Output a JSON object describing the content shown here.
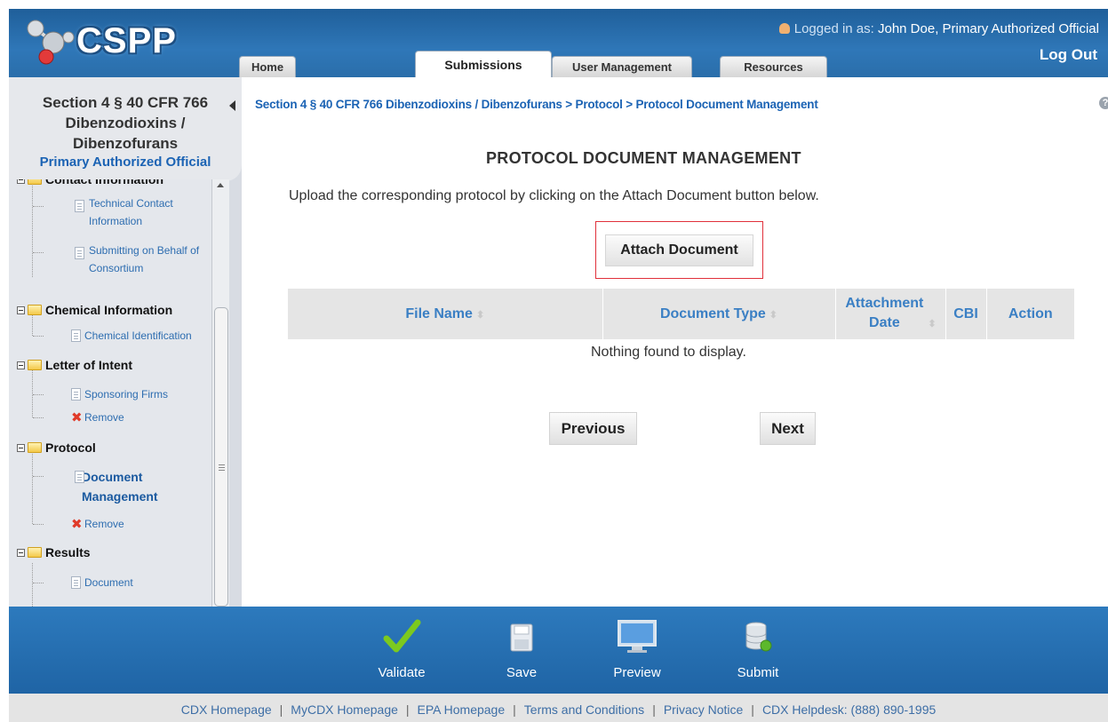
{
  "header": {
    "logo_text": "CSPP",
    "logged_in_prefix": "Logged in as: ",
    "logged_in_user": "John Doe, Primary Authorized Official",
    "logout": "Log Out",
    "tabs": [
      "Home",
      "Submissions",
      "User Management",
      "Resources"
    ],
    "active_tab": "Submissions"
  },
  "sidebar": {
    "title_lines": [
      "Section 4 § 40 CFR 766",
      "Dibenzodioxins /",
      "Dibenzofurans"
    ],
    "role": "Primary Authorized Official",
    "tree": [
      {
        "type": "folder",
        "label": "Contact Information"
      },
      {
        "type": "leaf",
        "label": "Technical Contact Information"
      },
      {
        "type": "leaf",
        "label": "Submitting on Behalf of Consortium"
      },
      {
        "type": "folder",
        "label": "Chemical Information"
      },
      {
        "type": "leaf",
        "label": "Chemical Identification"
      },
      {
        "type": "folder",
        "label": "Letter of Intent"
      },
      {
        "type": "leaf",
        "label": "Sponsoring Firms"
      },
      {
        "type": "remove",
        "label": "Remove"
      },
      {
        "type": "folder",
        "label": "Protocol"
      },
      {
        "type": "leaf",
        "label": "Document Management",
        "selected": true
      },
      {
        "type": "remove",
        "label": "Remove"
      },
      {
        "type": "folder",
        "label": "Results"
      },
      {
        "type": "leaf",
        "label": "Document"
      }
    ]
  },
  "main": {
    "breadcrumb": "Section 4 § 40 CFR 766 Dibenzodioxins / Dibenzofurans > Protocol > Protocol Document Management",
    "title": "PROTOCOL DOCUMENT MANAGEMENT",
    "instructions": "Upload the corresponding protocol by clicking on the Attach Document button below.",
    "attach_button": "Attach Document",
    "table": {
      "columns": [
        "File Name",
        "Document Type",
        "Attachment Date",
        "CBI",
        "Action"
      ],
      "rows": [],
      "empty_message": "Nothing found to display."
    },
    "previous_button": "Previous",
    "next_button": "Next"
  },
  "toolbar": {
    "validate": "Validate",
    "save": "Save",
    "preview": "Preview",
    "submit": "Submit"
  },
  "footer": {
    "links": [
      "CDX Homepage",
      "MyCDX Homepage",
      "EPA Homepage",
      "Terms and Conditions",
      "Privacy Notice",
      "CDX Helpdesk: (888) 890-1995"
    ]
  },
  "colors": {
    "header_blue": "#2a6eaa",
    "link_blue": "#1b63b4",
    "highlight_red": "#e0303a",
    "validate_green": "#6bbf1e"
  }
}
